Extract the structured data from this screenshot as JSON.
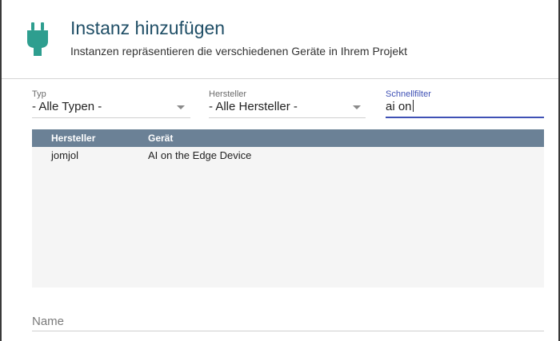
{
  "dialog": {
    "title": "Instanz hinzufügen",
    "subtitle": "Instanzen repräsentieren die verschiedenen Geräte in Ihrem Projekt",
    "icon": "plug-icon",
    "accent_color": "#2e9e8f"
  },
  "filters": {
    "type": {
      "label": "Typ",
      "value": "- Alle Typen -"
    },
    "manufacturer": {
      "label": "Hersteller",
      "value": "- Alle Hersteller -"
    },
    "quickfilter": {
      "label": "Schnellfilter",
      "value": "ai on"
    }
  },
  "table": {
    "columns": [
      "Hersteller",
      "Gerät"
    ],
    "rows": [
      {
        "manufacturer": "jomjol",
        "device": "AI on the Edge Device"
      }
    ]
  },
  "name_field": {
    "placeholder": "Name"
  }
}
